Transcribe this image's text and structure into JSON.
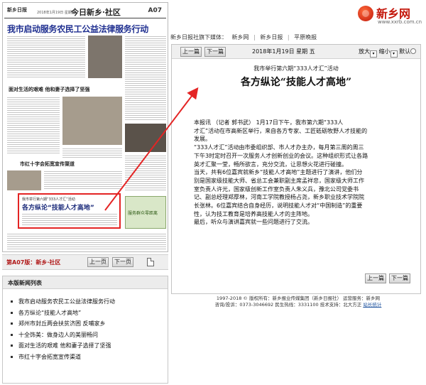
{
  "newspaper_page": {
    "logo": "新乡日报",
    "date_line": "2018年1月19日 星期五",
    "section_title": "今日新乡·社区",
    "page_no": "A07",
    "headline": "我市启动服务农民工公益法律服务行动",
    "sub_headline_1": "面对生活的艰难 他和妻子选择了坚强",
    "sub_headline_2": "市红十字会拓宽宣传渠道",
    "highlight_kicker": "我市举行第六期“333人才汇”活动",
    "highlight_title": "各方纵论“技能人才高地”",
    "ad_text": "服务群众零距离",
    "page_label": "第A07版：新乡·社区",
    "prev_label": "上一页",
    "next_label": "下一页"
  },
  "news_list": {
    "title": "本版新闻列表",
    "items": [
      "我市启动服务农民工公益法律服务行动",
      "各方纵论“技能人才高地”",
      "郑州市封丘两会扶贫济困 反哺家乡",
      "十全饰美：做身边人的美丽畅问",
      "面对生活的艰难 他和妻子选择了坚强",
      "市红十字会拓宽宣传渠道"
    ]
  },
  "site": {
    "logo_text": "新乡网",
    "url": "www.xxrb.com.cn",
    "media_bar": {
      "label": "新乡日报社旗下媒体：",
      "links": [
        "新乡网",
        "新乡日报",
        "平原晚报"
      ]
    }
  },
  "toolbar": {
    "prev": "上一篇",
    "next": "下一篇",
    "date": "2018年1月19日 星期 五",
    "zoom_in": "放大",
    "zoom_out": "缩小",
    "default": "默认"
  },
  "article": {
    "kicker": "我市举行第六期“333人才汇”活动",
    "title": "各方纵论“技能人才高地”",
    "paragraphs": [
      "本报讯 （记者 郭书武） 1月17日下午，我市第六期“333人",
      "才汇”活动在市高新区举行，来自各方专家、工匠砥砺牧野人才技能的",
      "发展。",
      "“333人才汇”活动由市委组织部、市人才办主办，每月第三周的周三",
      "下午3时定时召开一次服务人才创新创业的会议。这种组织形式让各路",
      "英才汇聚一堂，畅所欲言，充分交流，让思想火花进行碰撞。",
      "当天，共有6位嘉宾就新乡“技能人才高地”主题进行了演讲，他们分",
      "别是国家级技能大师、省总工会兼职副主席孟祥忠，国家级大师工作",
      "室负责人许光，国家级创新工作室负责人朱义兵，豫北公司党委书",
      "记、副总经理郑厚林，河南工学院教授杨占尧，新乡职业技术学院院",
      "长张林。6位嘉宾结合自身经历，说明技能人才对“中国制造”的重要",
      "性，认为技工教育是培养高技能人才的主阵地。",
      "最后，听众与演讲嘉宾就一些问题进行了交流。"
    ],
    "prev": "上一篇",
    "next": "下一篇"
  },
  "footer": {
    "line1": "1997-2018 © 版权所有：新乡报业传媒集团（新乡日报社） 运营服务：新乡网",
    "line2": "咨询/投诉：0373-3046692 民生热线：3331100 技术支持：北大方正",
    "stats_link": "站长统计"
  },
  "colors": {
    "accent_red": "#e42424",
    "headline_blue": "#1f2f90",
    "logo_red": "#c4180c"
  }
}
